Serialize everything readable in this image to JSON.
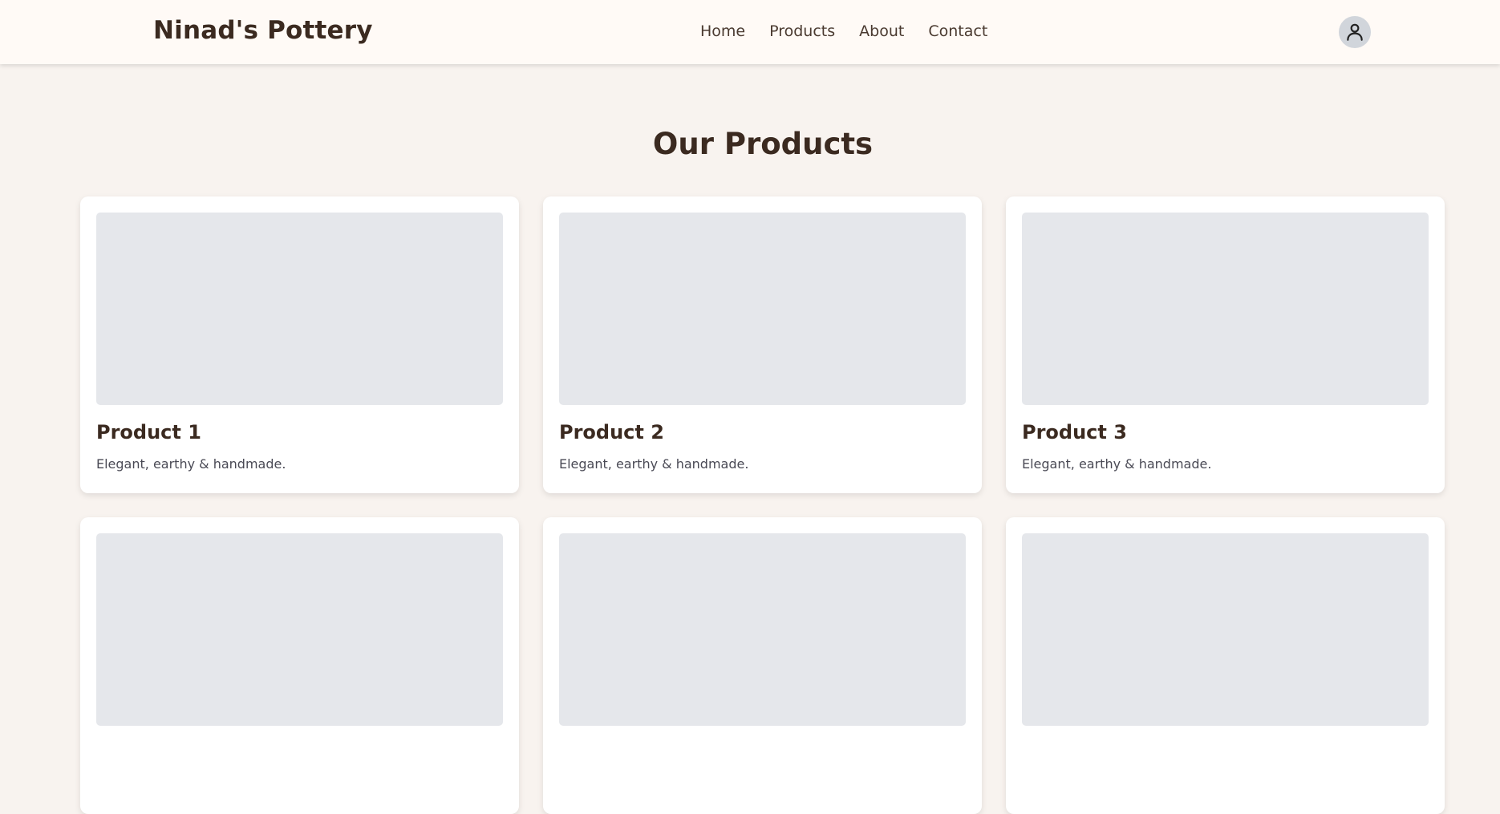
{
  "header": {
    "brand": "Ninad's Pottery",
    "nav": [
      {
        "label": "Home"
      },
      {
        "label": "Products"
      },
      {
        "label": "About"
      },
      {
        "label": "Contact"
      }
    ],
    "avatar_icon": "user-icon"
  },
  "main": {
    "title": "Our Products",
    "products": [
      {
        "name": "Product 1",
        "description": "Elegant, earthy & handmade."
      },
      {
        "name": "Product 2",
        "description": "Elegant, earthy & handmade."
      },
      {
        "name": "Product 3",
        "description": "Elegant, earthy & handmade."
      },
      {
        "name": "",
        "description": ""
      },
      {
        "name": "",
        "description": ""
      },
      {
        "name": "",
        "description": ""
      }
    ]
  },
  "colors": {
    "page_background": "#f8f3ef",
    "header_background": "#fffaf6",
    "text_dark": "#3b2a20",
    "image_placeholder": "#e5e7eb",
    "avatar_background": "#d1d5db"
  }
}
